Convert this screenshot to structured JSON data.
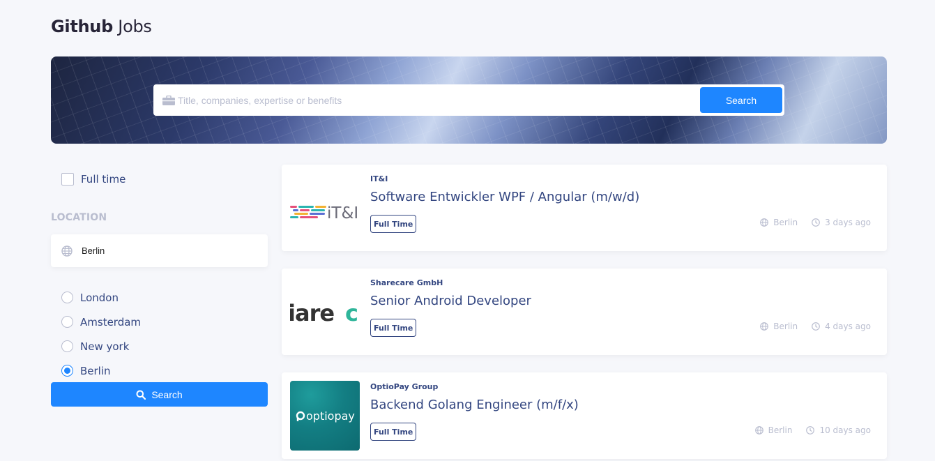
{
  "header": {
    "title_bold": "Github",
    "title_light": "Jobs"
  },
  "search": {
    "placeholder": "Title, companies, expertise or benefits",
    "button_label": "Search"
  },
  "filters": {
    "full_time_label": "Full time",
    "full_time_checked": false,
    "location_heading": "LOCATION",
    "location_value": "Berlin",
    "options": [
      {
        "label": "London",
        "selected": false
      },
      {
        "label": "Amsterdam",
        "selected": false
      },
      {
        "label": "New york",
        "selected": false
      },
      {
        "label": "Berlin",
        "selected": true
      }
    ],
    "search_label": "Search"
  },
  "jobs": [
    {
      "company": "IT&I",
      "title": "Software Entwickler WPF / Angular (m/w/d)",
      "type": "Full Time",
      "location": "Berlin",
      "posted": "3 days ago",
      "logo_text": "iT&I"
    },
    {
      "company": "Sharecare GmbH",
      "title": "Senior Android Developer",
      "type": "Full Time",
      "location": "Berlin",
      "posted": "4 days ago",
      "logo_text": "iarec"
    },
    {
      "company": "OptioPay Group",
      "title": "Backend Golang Engineer (m/f/x)",
      "type": "Full Time",
      "location": "Berlin",
      "posted": "10 days ago",
      "logo_text": "optiopay"
    }
  ],
  "colors": {
    "accent": "#1e86ff",
    "text": "#334680",
    "muted": "#b9bdcf",
    "background": "#f6f7fb"
  }
}
